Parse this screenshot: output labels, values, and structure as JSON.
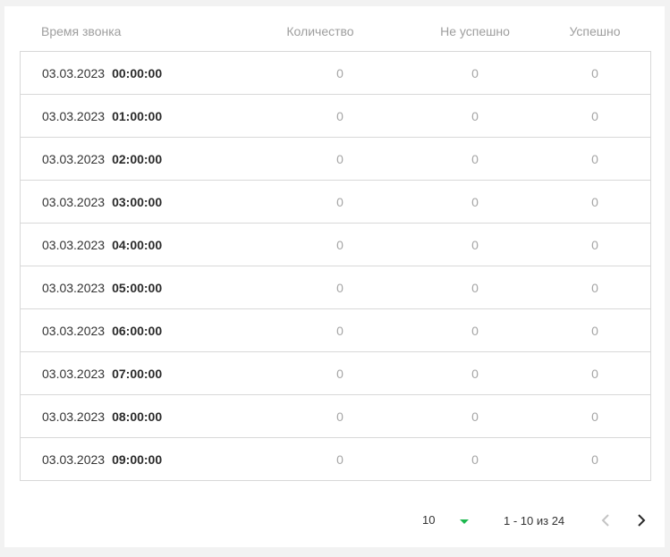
{
  "table": {
    "headers": {
      "time": "Время звонка",
      "count": "Количество",
      "fail": "Не успешно",
      "success": "Успешно"
    },
    "rows": [
      {
        "date": "03.03.2023",
        "time": "00:00:00",
        "count": "0",
        "fail": "0",
        "success": "0"
      },
      {
        "date": "03.03.2023",
        "time": "01:00:00",
        "count": "0",
        "fail": "0",
        "success": "0"
      },
      {
        "date": "03.03.2023",
        "time": "02:00:00",
        "count": "0",
        "fail": "0",
        "success": "0"
      },
      {
        "date": "03.03.2023",
        "time": "03:00:00",
        "count": "0",
        "fail": "0",
        "success": "0"
      },
      {
        "date": "03.03.2023",
        "time": "04:00:00",
        "count": "0",
        "fail": "0",
        "success": "0"
      },
      {
        "date": "03.03.2023",
        "time": "05:00:00",
        "count": "0",
        "fail": "0",
        "success": "0"
      },
      {
        "date": "03.03.2023",
        "time": "06:00:00",
        "count": "0",
        "fail": "0",
        "success": "0"
      },
      {
        "date": "03.03.2023",
        "time": "07:00:00",
        "count": "0",
        "fail": "0",
        "success": "0"
      },
      {
        "date": "03.03.2023",
        "time": "08:00:00",
        "count": "0",
        "fail": "0",
        "success": "0"
      },
      {
        "date": "03.03.2023",
        "time": "09:00:00",
        "count": "0",
        "fail": "0",
        "success": "0"
      }
    ]
  },
  "pagination": {
    "page_size": "10",
    "range_text": "1 - 10 из 24",
    "caret_color": "#1db84f",
    "prev_icon": "chevron-left-icon",
    "next_icon": "chevron-right-icon"
  }
}
